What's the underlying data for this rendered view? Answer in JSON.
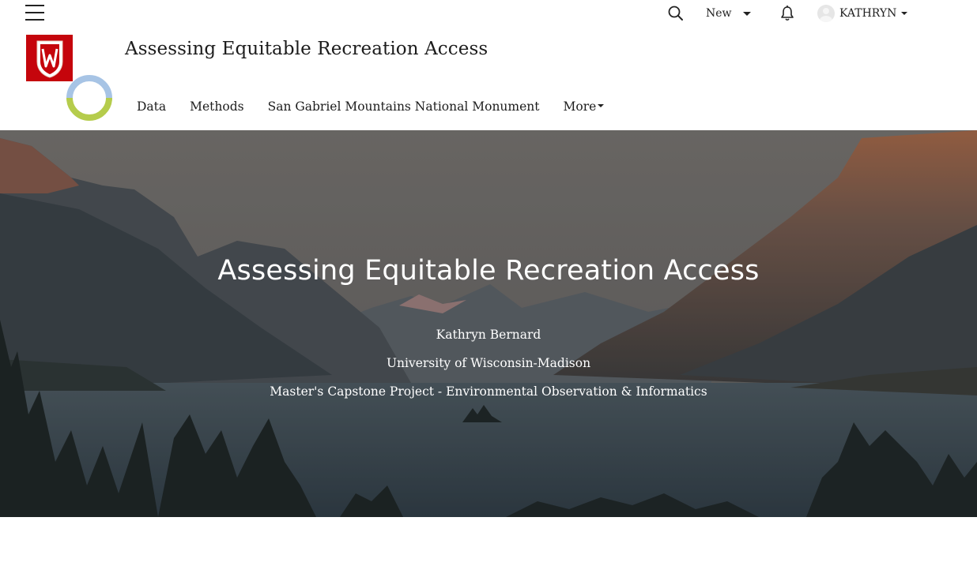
{
  "topbar": {
    "new_label": "New",
    "user_name": "KATHRYN",
    "icons": [
      "hamburger-menu-icon",
      "search-icon",
      "caret-down-icon",
      "bell-icon",
      "avatar",
      "caret-down-icon"
    ]
  },
  "header": {
    "site_title": "Assessing Equitable Recreation Access",
    "logo_letter": "W",
    "nav": [
      {
        "label": "Data"
      },
      {
        "label": "Methods"
      },
      {
        "label": "San Gabriel Mountains National Monument"
      },
      {
        "label": "More"
      }
    ]
  },
  "hero": {
    "title": "Assessing Equitable Recreation Access",
    "author": "Kathryn Bernard",
    "institution": "University of Wisconsin-Madison",
    "project": "Master's Capstone Project - Environmental Observation & Informatics"
  },
  "colors": {
    "uw_red": "#c5050c",
    "ring_blue": "#a7c4e5",
    "ring_green": "#b5cc4c",
    "hero_overlay": "#2f3a40"
  }
}
